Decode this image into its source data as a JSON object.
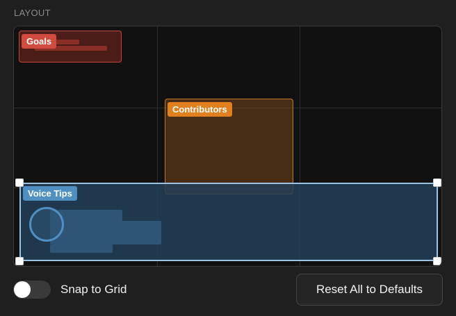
{
  "section": {
    "title": "LAYOUT"
  },
  "widgets": {
    "goals": {
      "label": "Goals",
      "color": "#d24b3f"
    },
    "contributors": {
      "label": "Contributors",
      "color": "#e0801f"
    },
    "voice_tips": {
      "label": "Voice Tips",
      "color": "#4f8fc2",
      "selected": true
    }
  },
  "controls": {
    "snap_to_grid": {
      "label": "Snap to Grid",
      "enabled": false
    },
    "reset_button": {
      "label": "Reset All to Defaults"
    }
  }
}
